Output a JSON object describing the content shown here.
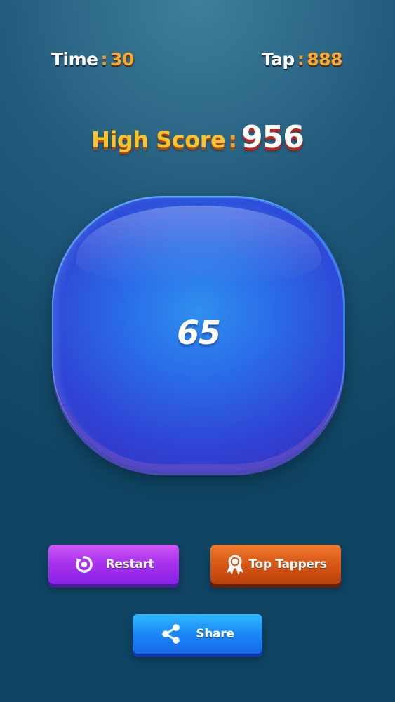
{
  "stats": {
    "time_label": "Time",
    "time_value": "30",
    "tap_label": "Tap",
    "tap_value": "888",
    "separator": ":"
  },
  "high_score": {
    "label": "High Score",
    "separator": ":",
    "value": "956"
  },
  "tap_pad": {
    "count": "65"
  },
  "buttons": {
    "restart": {
      "label": "Restart",
      "icon": "restart-icon"
    },
    "top_tappers": {
      "label": "Top Tappers",
      "icon": "award-ribbon-icon"
    },
    "share": {
      "label": "Share",
      "icon": "share-icon"
    }
  },
  "colors": {
    "background": "#1e5877",
    "accent_orange": "#f7a72c",
    "high_score_gold": "#f8c32d",
    "pad_blue": "#2a6ee8",
    "restart_purple": "#a833ee",
    "top_tappers_orange": "#d85716",
    "share_blue": "#1a87f6"
  }
}
